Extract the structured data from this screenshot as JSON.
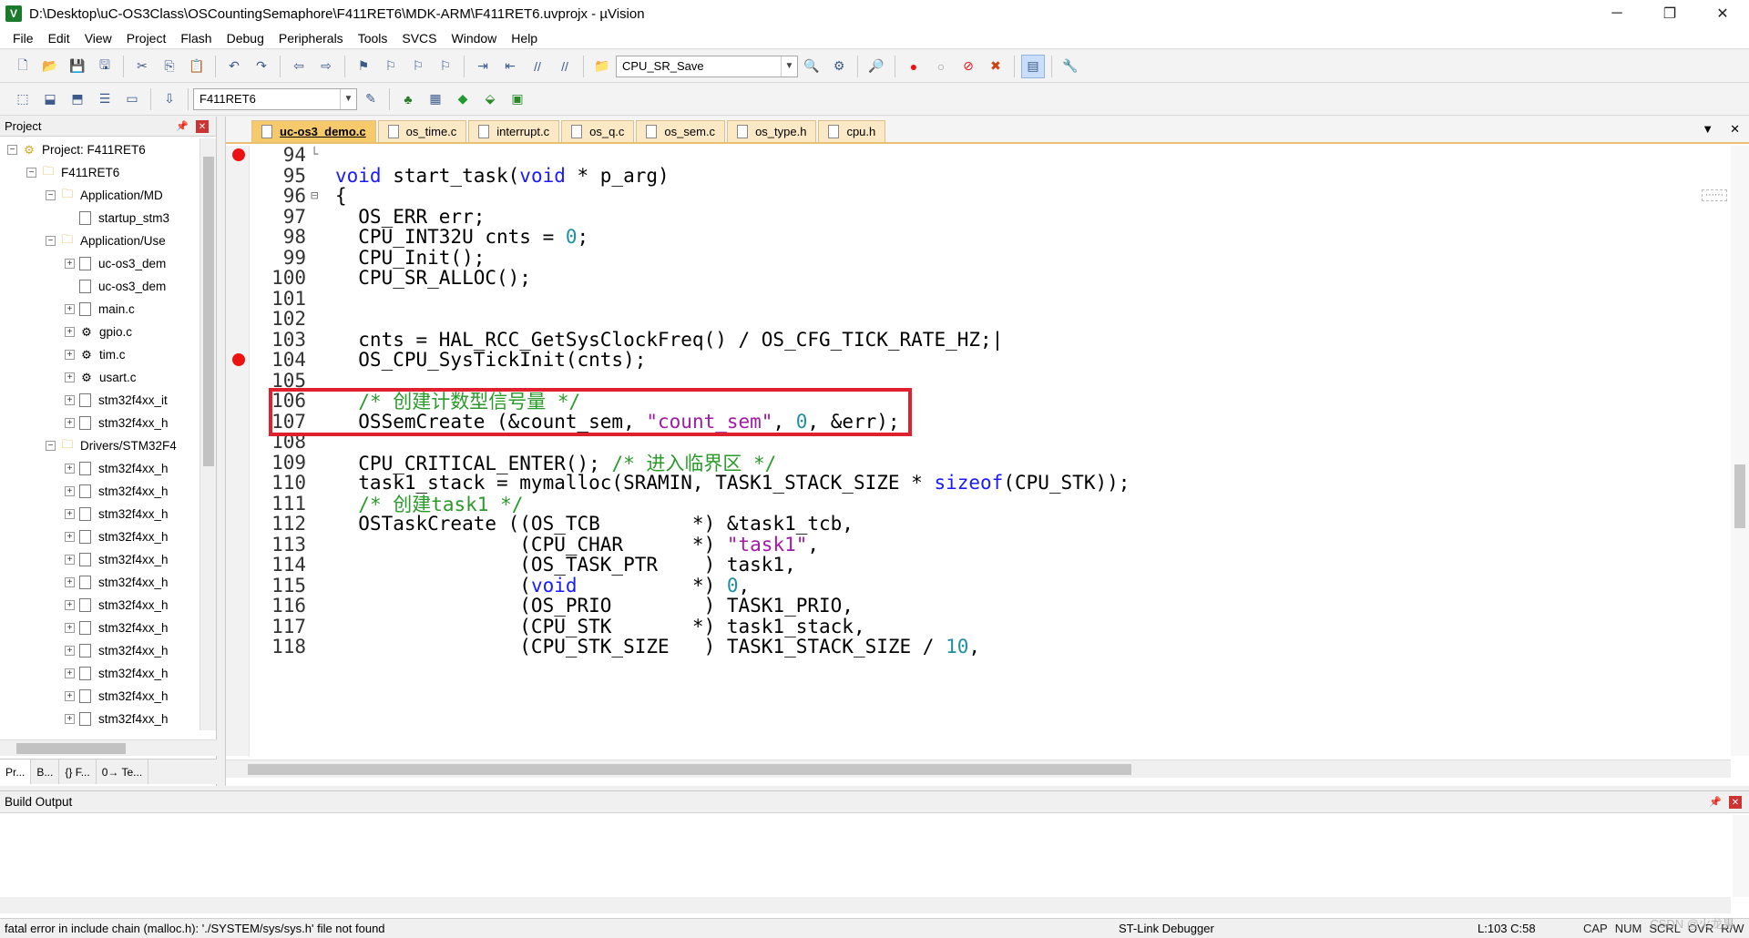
{
  "window": {
    "title": "D:\\Desktop\\uC-OS3Class\\OSCountingSemaphore\\F411RET6\\MDK-ARM\\F411RET6.uvprojx - µVision"
  },
  "menu": [
    "File",
    "Edit",
    "View",
    "Project",
    "Flash",
    "Debug",
    "Peripherals",
    "Tools",
    "SVCS",
    "Window",
    "Help"
  ],
  "toolbar": {
    "find_combo": "CPU_SR_Save",
    "target_combo": "F411RET6"
  },
  "project_panel": {
    "title": "Project",
    "tree": [
      {
        "label": "Project: F411RET6",
        "level": 0,
        "kind": "project",
        "exp": "-"
      },
      {
        "label": "F411RET6",
        "level": 1,
        "kind": "target",
        "exp": "-"
      },
      {
        "label": "Application/MD",
        "level": 2,
        "kind": "folder",
        "exp": "-"
      },
      {
        "label": "startup_stm3",
        "level": 3,
        "kind": "file",
        "exp": ""
      },
      {
        "label": "Application/Use",
        "level": 2,
        "kind": "folder",
        "exp": "-"
      },
      {
        "label": "uc-os3_dem",
        "level": 3,
        "kind": "file",
        "exp": "+"
      },
      {
        "label": "uc-os3_dem",
        "level": 3,
        "kind": "file",
        "exp": ""
      },
      {
        "label": "main.c",
        "level": 3,
        "kind": "file",
        "exp": "+"
      },
      {
        "label": "gpio.c",
        "level": 3,
        "kind": "gear",
        "exp": "+"
      },
      {
        "label": "tim.c",
        "level": 3,
        "kind": "gear",
        "exp": "+"
      },
      {
        "label": "usart.c",
        "level": 3,
        "kind": "gear",
        "exp": "+"
      },
      {
        "label": "stm32f4xx_it",
        "level": 3,
        "kind": "file",
        "exp": "+"
      },
      {
        "label": "stm32f4xx_h",
        "level": 3,
        "kind": "file",
        "exp": "+"
      },
      {
        "label": "Drivers/STM32F4",
        "level": 2,
        "kind": "folder",
        "exp": "-"
      },
      {
        "label": "stm32f4xx_h",
        "level": 3,
        "kind": "file",
        "exp": "+"
      },
      {
        "label": "stm32f4xx_h",
        "level": 3,
        "kind": "file",
        "exp": "+"
      },
      {
        "label": "stm32f4xx_h",
        "level": 3,
        "kind": "file",
        "exp": "+"
      },
      {
        "label": "stm32f4xx_h",
        "level": 3,
        "kind": "file",
        "exp": "+"
      },
      {
        "label": "stm32f4xx_h",
        "level": 3,
        "kind": "file",
        "exp": "+"
      },
      {
        "label": "stm32f4xx_h",
        "level": 3,
        "kind": "file",
        "exp": "+"
      },
      {
        "label": "stm32f4xx_h",
        "level": 3,
        "kind": "file",
        "exp": "+"
      },
      {
        "label": "stm32f4xx_h",
        "level": 3,
        "kind": "file",
        "exp": "+"
      },
      {
        "label": "stm32f4xx_h",
        "level": 3,
        "kind": "file",
        "exp": "+"
      },
      {
        "label": "stm32f4xx_h",
        "level": 3,
        "kind": "file",
        "exp": "+"
      },
      {
        "label": "stm32f4xx_h",
        "level": 3,
        "kind": "file",
        "exp": "+"
      },
      {
        "label": "stm32f4xx_h",
        "level": 3,
        "kind": "file",
        "exp": "+"
      }
    ],
    "tabs": [
      "Pr...",
      "B...",
      "{} F...",
      "0→ Te..."
    ]
  },
  "editor": {
    "tabs": [
      {
        "label": "uc-os3_demo.c",
        "active": true
      },
      {
        "label": "os_time.c",
        "active": false
      },
      {
        "label": "interrupt.c",
        "active": false
      },
      {
        "label": "os_q.c",
        "active": false
      },
      {
        "label": "os_sem.c",
        "active": false
      },
      {
        "label": "os_type.h",
        "active": false
      },
      {
        "label": "cpu.h",
        "active": false
      }
    ],
    "lines": [
      {
        "n": "94",
        "fold": "└",
        "bp": true,
        "html": ""
      },
      {
        "n": "95",
        "fold": "",
        "bp": false,
        "html": "<span class=\"kw\">void</span> start_task(<span class=\"kw\">void</span> * p_arg)"
      },
      {
        "n": "96",
        "fold": "⊟",
        "bp": false,
        "html": "{"
      },
      {
        "n": "97",
        "fold": "",
        "bp": false,
        "html": "  OS_ERR err;"
      },
      {
        "n": "98",
        "fold": "",
        "bp": false,
        "html": "  CPU_INT32U cnts = <span class=\"num\">0</span>;"
      },
      {
        "n": "99",
        "fold": "",
        "bp": false,
        "html": "  CPU_Init();"
      },
      {
        "n": "100",
        "fold": "",
        "bp": false,
        "html": "  CPU_SR_ALLOC();"
      },
      {
        "n": "101",
        "fold": "",
        "bp": false,
        "html": ""
      },
      {
        "n": "102",
        "fold": "",
        "bp": false,
        "html": ""
      },
      {
        "n": "103",
        "fold": "",
        "bp": false,
        "html": "  cnts = HAL_RCC_GetSysClockFreq() / OS_CFG_TICK_RATE_HZ;|"
      },
      {
        "n": "104",
        "fold": "",
        "bp": true,
        "html": "  OS_CPU_SysTickInit(cnts);"
      },
      {
        "n": "105",
        "fold": "",
        "bp": false,
        "html": ""
      },
      {
        "n": "106",
        "fold": "",
        "bp": false,
        "html": "  <span class=\"cmt\">/* 创建计数型信号量 */</span>"
      },
      {
        "n": "107",
        "fold": "",
        "bp": false,
        "html": "  OSSemCreate (&amp;count_sem, <span class=\"str\">\"count_sem\"</span>, <span class=\"num\">0</span>, &amp;err);"
      },
      {
        "n": "108",
        "fold": "",
        "bp": false,
        "html": ""
      },
      {
        "n": "109",
        "fold": "",
        "bp": false,
        "html": "  CPU_CRITICAL_ENTER(); <span class=\"cmt\">/* 进入临界区 */</span>"
      },
      {
        "n": "110",
        "fold": "",
        "bp": false,
        "html": "  task1_stack = mymalloc(SRAMIN, TASK1_STACK_SIZE * <span class=\"kw\">sizeof</span>(CPU_STK));"
      },
      {
        "n": "111",
        "fold": "",
        "bp": false,
        "html": "  <span class=\"cmt\">/* 创建task1 */</span>"
      },
      {
        "n": "112",
        "fold": "",
        "bp": false,
        "html": "  OSTaskCreate ((OS_TCB        *) &amp;task1_tcb,"
      },
      {
        "n": "113",
        "fold": "",
        "bp": false,
        "html": "                (CPU_CHAR      *) <span class=\"str\">\"task1\"</span>,"
      },
      {
        "n": "114",
        "fold": "",
        "bp": false,
        "html": "                (OS_TASK_PTR    ) task1,"
      },
      {
        "n": "115",
        "fold": "",
        "bp": false,
        "html": "                (<span class=\"kw\">void</span>          *) <span class=\"num\">0</span>,"
      },
      {
        "n": "116",
        "fold": "",
        "bp": false,
        "html": "                (OS_PRIO        ) TASK1_PRIO,"
      },
      {
        "n": "117",
        "fold": "",
        "bp": false,
        "html": "                (CPU_STK       *) task1_stack,"
      },
      {
        "n": "118",
        "fold": "",
        "bp": false,
        "html": "                (CPU_STK_SIZE   ) TASK1_STACK_SIZE / <span class=\"num\">10</span>,"
      }
    ]
  },
  "build_output": {
    "title": "Build Output"
  },
  "status": {
    "message": "fatal error in include chain (malloc.h): './SYSTEM/sys/sys.h' file not found",
    "debugger": "ST-Link Debugger",
    "position": "L:103 C:58",
    "flags": [
      "CAP",
      "NUM",
      "SCRL",
      "OVR",
      "R/W"
    ],
    "watermark": "CSDN @火龙果"
  }
}
